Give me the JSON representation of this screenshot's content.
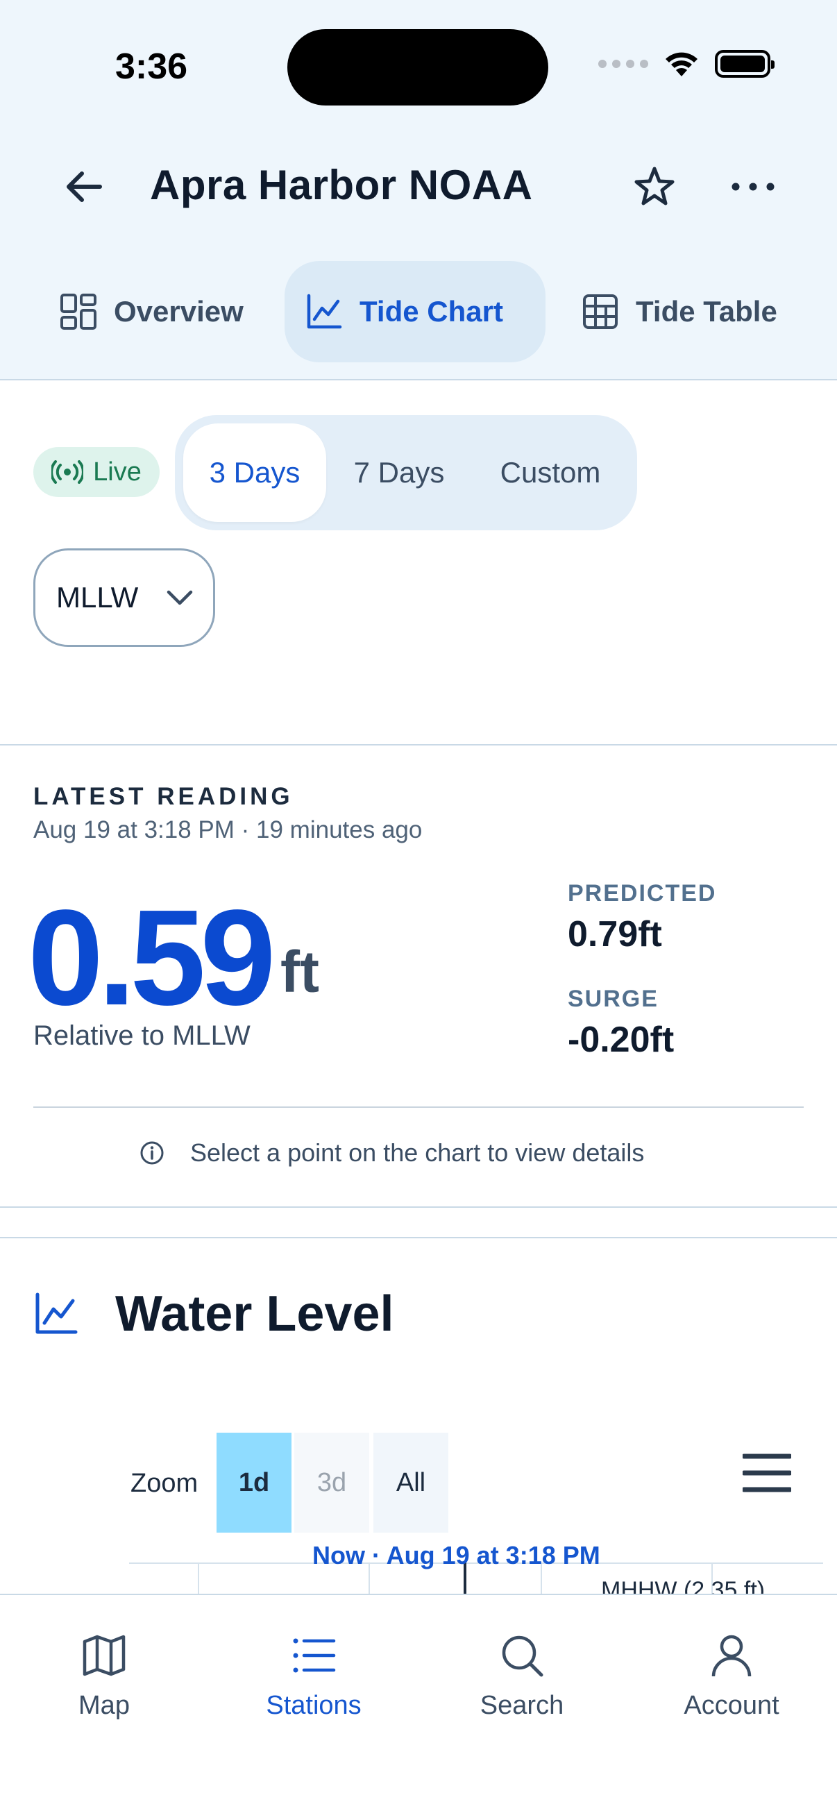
{
  "status_bar": {
    "time": "3:36"
  },
  "header": {
    "title": "Apra Harbor NOAA"
  },
  "tabs": [
    {
      "label": "Overview",
      "icon": "grid-icon"
    },
    {
      "label": "Tide Chart",
      "icon": "line-chart-icon",
      "active": true
    },
    {
      "label": "Tide Table",
      "icon": "table-icon"
    }
  ],
  "range": {
    "live_label": "Live",
    "options": [
      "3 Days",
      "7 Days",
      "Custom"
    ],
    "selected": "3 Days"
  },
  "datum": {
    "selected": "MLLW"
  },
  "latest_reading": {
    "heading": "LATEST READING",
    "time": "Aug 19 at 3:18 PM · 19 minutes ago",
    "value": "0.59",
    "unit": "ft",
    "relative": "Relative to MLLW",
    "predicted_label": "PREDICTED",
    "predicted_value": "0.79ft",
    "surge_label": "SURGE",
    "surge_value": "-0.20ft",
    "hint": "Select a point on the chart to view details"
  },
  "water_level": {
    "title": "Water Level",
    "zoom_label": "Zoom",
    "zoom_options": [
      "1d",
      "3d",
      "All"
    ],
    "zoom_selected": "1d",
    "now_label": "Now · Aug 19 at 3:18 PM",
    "mhhw_label": "MHHW (2.35 ft)"
  },
  "bottom_nav": [
    {
      "label": "Map",
      "icon": "map-icon"
    },
    {
      "label": "Stations",
      "icon": "list-icon",
      "active": true
    },
    {
      "label": "Search",
      "icon": "search-icon"
    },
    {
      "label": "Account",
      "icon": "user-icon"
    }
  ],
  "colors": {
    "accent": "#1556cf",
    "reading": "#0b4ad0",
    "header_bg": "#eef6fc",
    "live_green": "#1a7a52",
    "zoom_active": "#8fdcff"
  }
}
